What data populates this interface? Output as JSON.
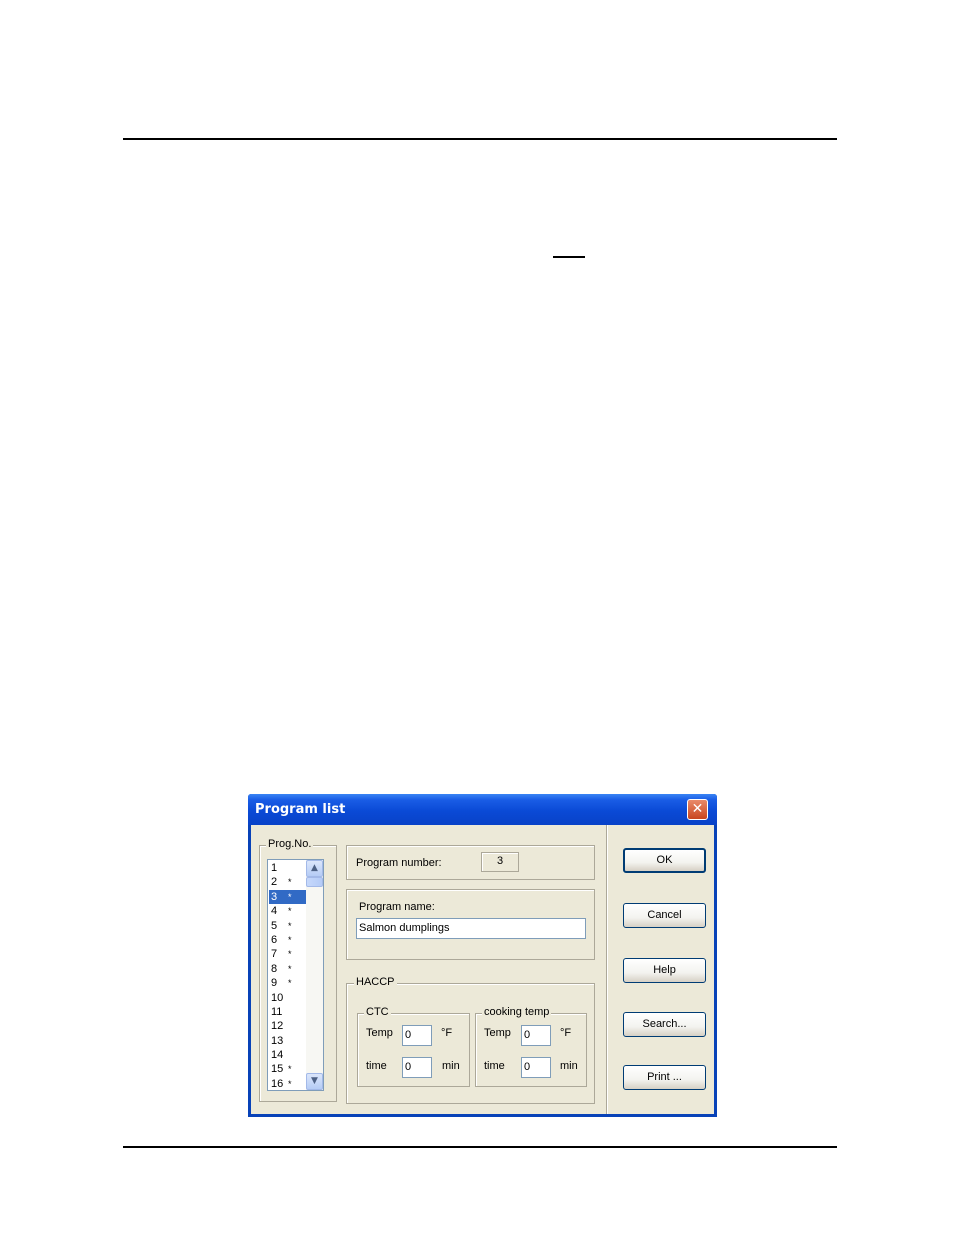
{
  "dialog": {
    "title": "Program list",
    "close_symbol": "✕",
    "prog_list": {
      "legend": "Prog.No.",
      "items": [
        {
          "label": "1",
          "marker": ""
        },
        {
          "label": "2",
          "marker": "*"
        },
        {
          "label": "3",
          "marker": "*"
        },
        {
          "label": "4",
          "marker": "*"
        },
        {
          "label": "5",
          "marker": "*"
        },
        {
          "label": "6",
          "marker": "*"
        },
        {
          "label": "7",
          "marker": "*"
        },
        {
          "label": "8",
          "marker": "*"
        },
        {
          "label": "9",
          "marker": "*"
        },
        {
          "label": "10",
          "marker": ""
        },
        {
          "label": "11",
          "marker": ""
        },
        {
          "label": "12",
          "marker": ""
        },
        {
          "label": "13",
          "marker": ""
        },
        {
          "label": "14",
          "marker": ""
        },
        {
          "label": "15",
          "marker": "*"
        },
        {
          "label": "16",
          "marker": "*"
        }
      ],
      "selected_index": 2,
      "scroll_up_icon": "up-arrow-icon",
      "scroll_down_icon": "down-arrow-icon"
    },
    "program_number": {
      "label": "Program number:",
      "value": "3"
    },
    "program_name": {
      "label": "Program name:",
      "value": "Salmon dumplings"
    },
    "haccp": {
      "legend": "HACCP",
      "ctc": {
        "legend": "CTC",
        "temp_label": "Temp",
        "temp_value": "0",
        "temp_unit": "°F",
        "time_label": "time",
        "time_value": "0",
        "time_unit": "min"
      },
      "cooking_temp": {
        "legend": "cooking temp",
        "temp_label": "Temp",
        "temp_value": "0",
        "temp_unit": "°F",
        "time_label": "time",
        "time_value": "0",
        "time_unit": "min"
      }
    },
    "buttons": {
      "ok": "OK",
      "cancel": "Cancel",
      "help": "Help",
      "search": "Search...",
      "print": "Print ..."
    }
  },
  "colors": {
    "titlebar": "#0a4ad6",
    "selection": "#316ac5",
    "dialog_face": "#ece9d8"
  }
}
